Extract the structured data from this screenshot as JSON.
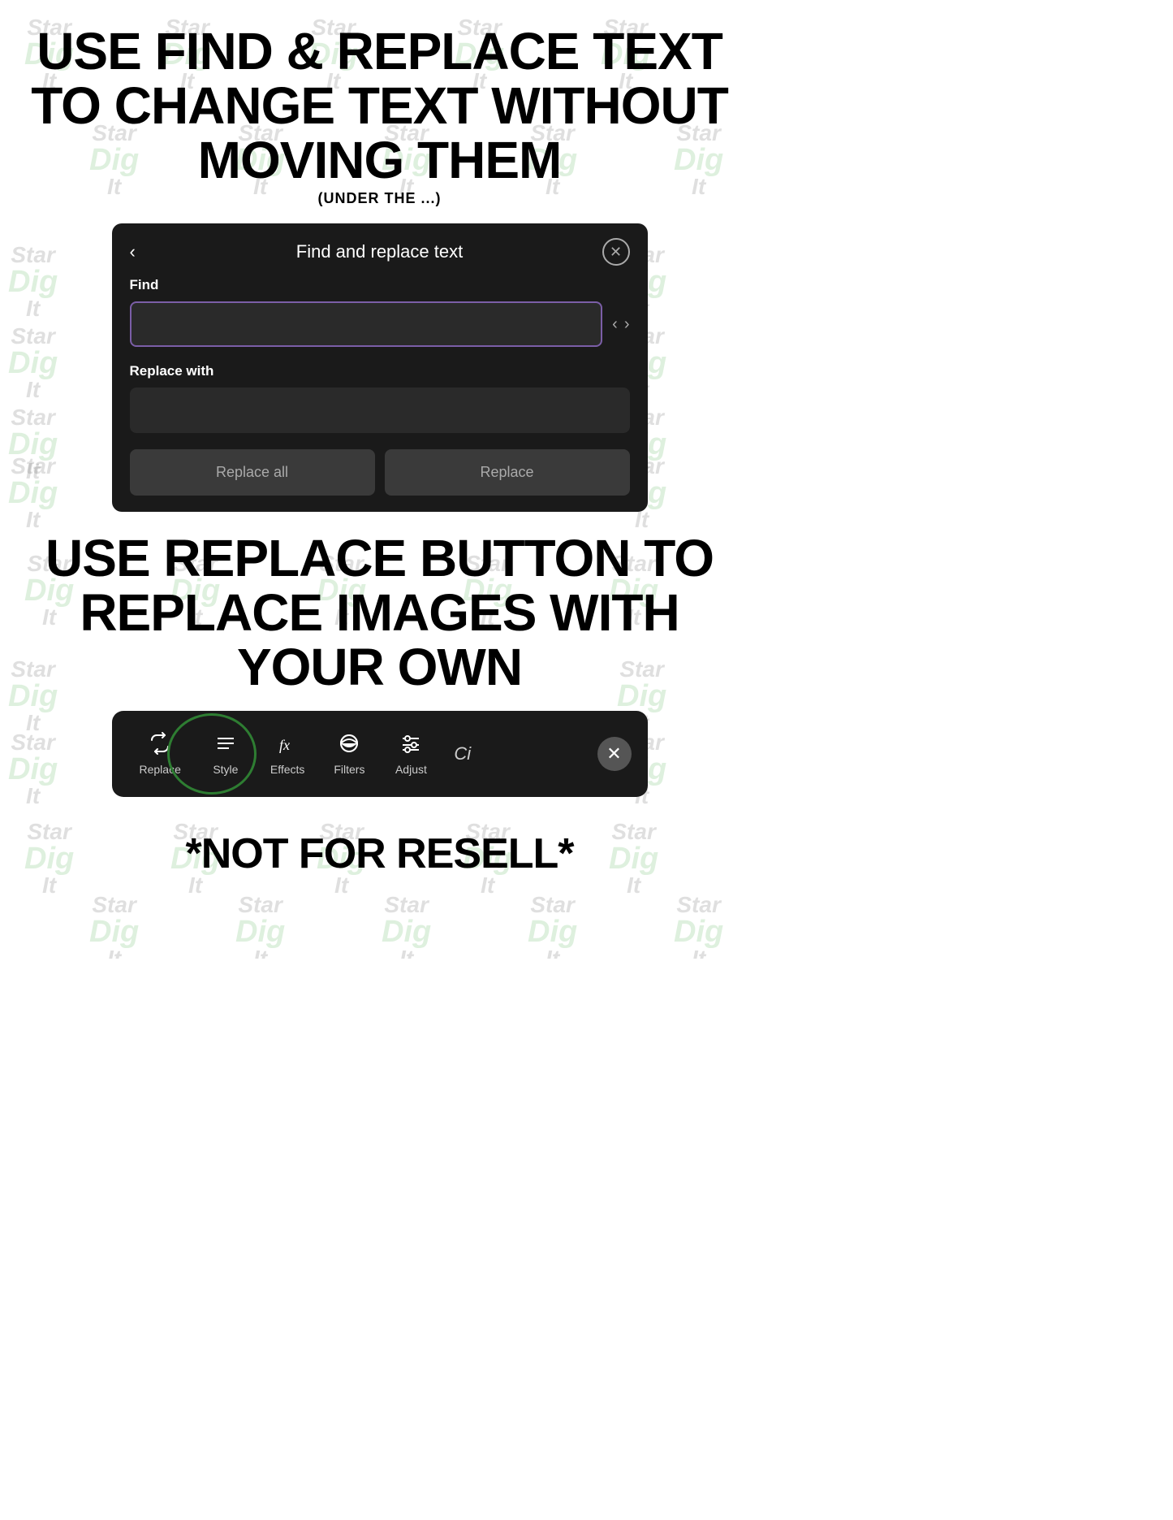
{
  "title1": {
    "line1": "USE FIND & REPLACE TEXT",
    "line2": "TO CHANGE TEXT WITHOUT",
    "line3": "MOVING THEM",
    "subtitle": "(UNDER THE ...)"
  },
  "dialog": {
    "title": "Find and replace text",
    "back_label": "‹",
    "close_label": "✕",
    "find_label": "Find",
    "find_placeholder": "",
    "replace_with_label": "Replace with",
    "replace_with_placeholder": "",
    "btn_replace_all": "Replace all",
    "btn_replace": "Replace"
  },
  "title2": {
    "line1": "USE REPLACE BUTTON TO",
    "line2": "REPLACE IMAGES WITH",
    "line3": "YOUR OWN"
  },
  "toolbar": {
    "replace_label": "Replace",
    "style_label": "Style",
    "effects_label": "Effects",
    "filters_label": "Filters",
    "adjust_label": "Adjust",
    "ci_label": "Ci",
    "close_label": "✕"
  },
  "footer": {
    "text": "*NOT FOR RESELL*"
  },
  "watermarks": [
    {
      "top": "Star",
      "mid": "Dig",
      "bot": "It"
    },
    {
      "top": "Star",
      "mid": "Dig",
      "bot": "It"
    },
    {
      "top": "Star",
      "mid": "Dig",
      "bot": "It"
    },
    {
      "top": "Star",
      "mid": "Dig",
      "bot": "It"
    },
    {
      "top": "Star",
      "mid": "Dig",
      "bot": "It"
    },
    {
      "top": "Star",
      "mid": "Dig",
      "bot": "It"
    },
    {
      "top": "Star",
      "mid": "Dig",
      "bot": "It"
    },
    {
      "top": "Star",
      "mid": "Dig",
      "bot": "It"
    },
    {
      "top": "Star",
      "mid": "Dig",
      "bot": "It"
    },
    {
      "top": "Star",
      "mid": "Dig",
      "bot": "It"
    },
    {
      "top": "Star",
      "mid": "Dig",
      "bot": "It"
    },
    {
      "top": "Star",
      "mid": "Dig",
      "bot": "It"
    }
  ]
}
